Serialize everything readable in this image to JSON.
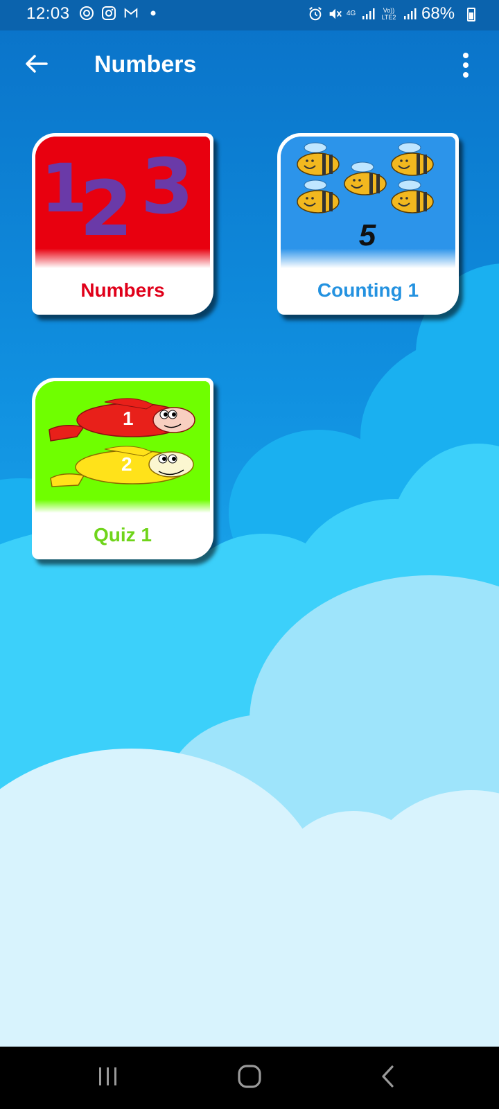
{
  "status_bar": {
    "time": "12:03",
    "battery": "68%",
    "network_4g": "4G",
    "volte": "Vo)) LTE2",
    "left_icons": [
      "sync-icon",
      "instagram-icon",
      "gmail-icon",
      "dot-icon"
    ],
    "right_icons": [
      "alarm-icon",
      "mute-icon",
      "signal-icon",
      "signal-icon",
      "battery-icon"
    ]
  },
  "app_bar": {
    "title": "Numbers",
    "back_icon": "back-arrow-icon",
    "menu_icon": "more-vertical-icon"
  },
  "cards": [
    {
      "label": "Numbers",
      "label_color": "#e0001a",
      "image_bg": "#e8000f",
      "image": "123-digits"
    },
    {
      "label": "Counting 1",
      "label_color": "#2492e0",
      "image_bg": "#2c94ea",
      "image": "five-bees",
      "number": "5"
    },
    {
      "label": "Quiz 1",
      "label_color": "#6fd41a",
      "image_bg": "#6fff00",
      "image": "two-fish",
      "fish_numbers": [
        "1",
        "2"
      ]
    }
  ],
  "nav_bar": {
    "recents_icon": "recents-icon",
    "home_icon": "home-icon",
    "back_icon": "nav-back-icon"
  },
  "colors": {
    "sky_top": "#0a72c8",
    "cloud_light": "#d8f3fd",
    "status_bar": "#0b63ad"
  }
}
